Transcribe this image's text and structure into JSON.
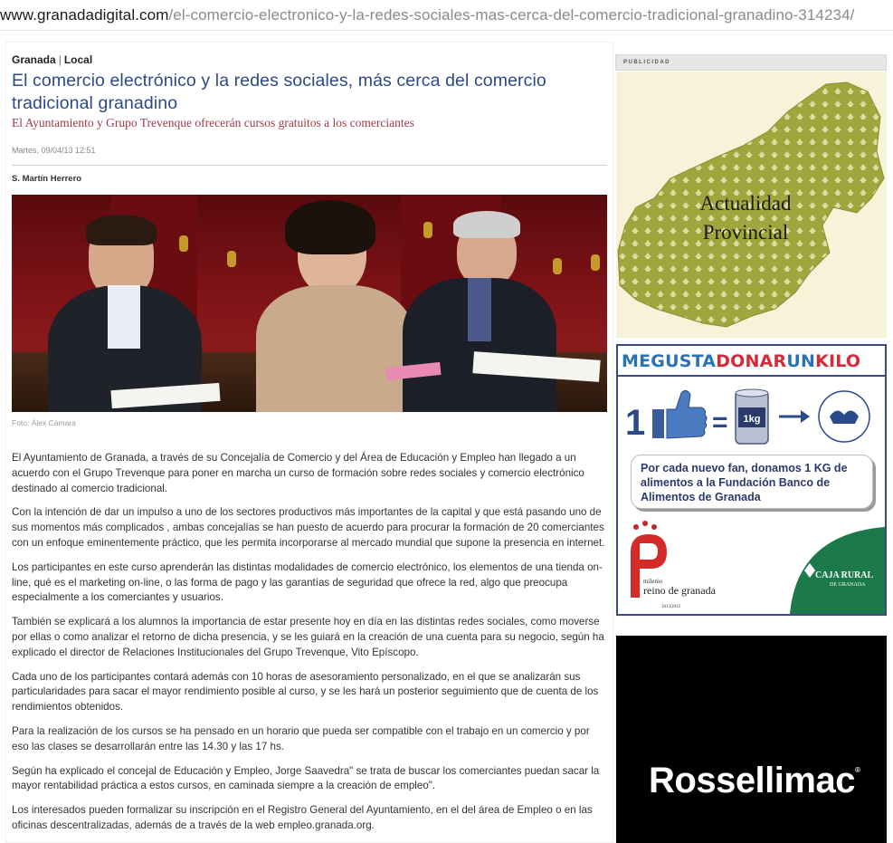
{
  "browser": {
    "url_host": "www.granadadigital.com",
    "url_path": "/el-comercio-electronico-y-la-redes-sociales-mas-cerca-del-comercio-tradicional-granadino-314234/"
  },
  "article": {
    "section": "Granada",
    "subsection": "Local",
    "headline": "El comercio electrónico y la redes sociales, más cerca del comercio tradicional granadino",
    "subhead": "El Ayuntamiento y Grupo Trevenque ofrecerán cursos gratuitos a los comerciantes",
    "date": "Martes, 09/04/13 12:51",
    "author": "S. Martín Herrero",
    "photo_caption": "Foto: Álex Cámara",
    "paragraphs": [
      "El Ayuntamiento de Granada, a través de su Concejalía de Comercio y del Área de Educación y Empleo han llegado a un acuerdo con el Grupo Trevenque para poner en marcha un curso de formación sobre redes sociales y comercio electrónico destinado al comercio tradicional.",
      "Con la intención de dar un impulso a uno de los sectores productivos más importantes de la capital y que está pasando uno de sus momentos más complicados , ambas concejalías se han puesto de acuerdo para procurar la formación de 20 comerciantes con un enfoque eminentemente práctico, que les permita incorporarse al mercado mundial que supone la presencia en internet.",
      "Los participantes en este curso aprenderán las distintas modalidades de comercio electrónico, los elementos de una tienda on-line, qué es el marketing on-line, o las forma de pago y las garantías de seguridad que ofrece la red, algo que preocupa especialmente a los comerciantes y usuarios.",
      "También se explicará a los alumnos la importancia de estar presente hoy en día en las distintas redes sociales, como moverse por ellas o como analizar el retorno de dicha presencia, y se les guiará en la creación de una cuenta para su negocio, según ha explicado el director de Relaciones Institucionales del Grupo Trevenque, Vito Epíscopo.",
      "Cada uno de los participantes contará además con 10 horas de asesoramiento personalizado, en el que se analizarán sus particularidades para sacar el mayor rendimiento posible al curso, y se les hará un posterior seguimiento que de cuenta de los rendimientos obtenidos.",
      "Para la realización de los cursos se ha pensado en un horario que pueda ser compatible con el trabajo en un comercio y por eso las clases se desarrollarán entre las 14.30 y las 17 hs.",
      "Según ha explicado el concejal de Educación y Empleo, Jorge Saavedra\" se trata de buscar los comerciantes puedan sacar la mayor rentabilidad práctica a estos cursos, en caminada siempre a la creación de empleo\".",
      "Los interesados pueden formalizar su inscripción en el Registro General del Ayuntamiento, en el del área de Empleo o en las oficinas descentralizadas, además de a través de la web empleo.granada.org."
    ]
  },
  "sidebar": {
    "ad_label": "PUBLICIDAD",
    "ad1": {
      "line1": "Actualidad",
      "line2": "Provincial"
    },
    "ad2": {
      "banner_me": "ME",
      "banner_gusta": "GUSTA",
      "banner_donar": "DONAR",
      "banner_un": "UN",
      "banner_kilo": "KILO",
      "one": "1",
      "equals": "=",
      "kg": "1kg",
      "message": "Por cada nuevo fan, donamos 1 KG de alimentos a la Fundación Banco de Alimentos de Granada",
      "milenio": "milenio",
      "reino": "reino de granada",
      "years": "1013|2013",
      "caja_rural": "CAJA RURAL",
      "de_granada": "DE GRANADA"
    },
    "ad3": {
      "brand": "Rossellimac",
      "mark": "®"
    }
  },
  "colors": {
    "headline": "#2a4a8a",
    "subhead": "#a23a4a",
    "olive": "#9aa03a",
    "donar_blue": "#2a72b8",
    "donar_red": "#d42a3a",
    "caja_green": "#1c7a4a"
  }
}
